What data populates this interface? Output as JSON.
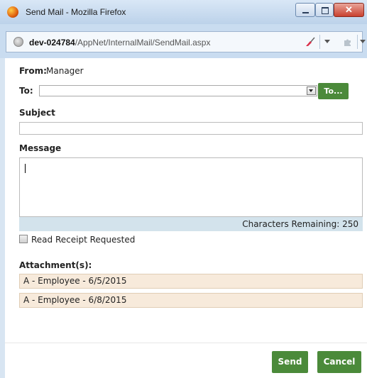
{
  "window": {
    "title": "Send Mail - Mozilla Firefox",
    "url_host": "dev-024784",
    "url_path": "/AppNet/InternalMail/SendMail.aspx"
  },
  "form": {
    "from_label": "From:",
    "from_value": "Manager",
    "to_label": "To:",
    "to_value": "",
    "to_button": "To...",
    "subject_label": "Subject",
    "subject_value": "",
    "message_label": "Message",
    "message_value": "",
    "chars_remaining": "Characters Remaining: 250",
    "read_receipt_label": "Read Receipt Requested",
    "read_receipt_checked": false,
    "attachments_label": "Attachment(s):",
    "attachments": [
      "A - Employee - 6/5/2015",
      "A - Employee - 6/8/2015"
    ]
  },
  "buttons": {
    "send": "Send",
    "cancel": "Cancel"
  },
  "colors": {
    "accent_green": "#4b8a3a",
    "attachment_bg": "#f7eadb",
    "char_bar_bg": "#d3e3ec"
  }
}
